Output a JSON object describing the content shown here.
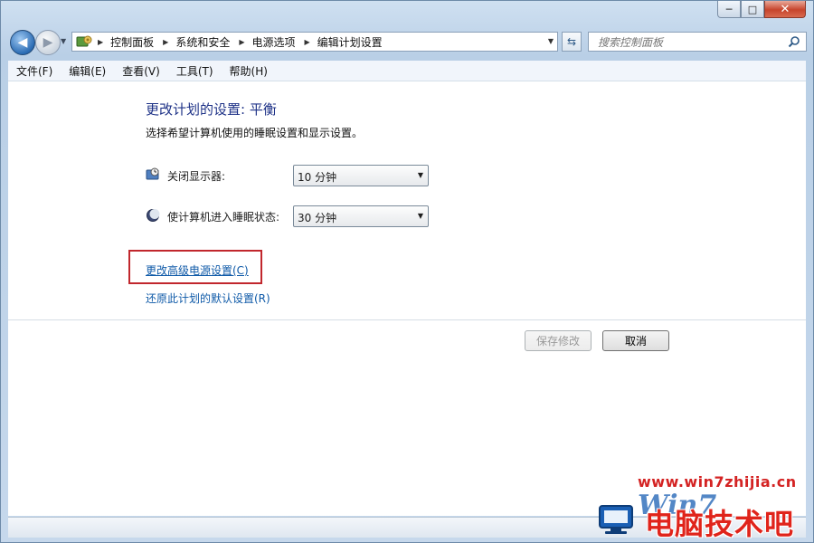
{
  "window": {
    "caption": {
      "minimize": "─",
      "maximize": "□",
      "close": "✕"
    }
  },
  "nav": {
    "breadcrumbs": [
      "控制面板",
      "系统和安全",
      "电源选项",
      "编辑计划设置"
    ],
    "search_placeholder": "搜索控制面板"
  },
  "menu": [
    "文件(F)",
    "编辑(E)",
    "查看(V)",
    "工具(T)",
    "帮助(H)"
  ],
  "content": {
    "title": "更改计划的设置: 平衡",
    "subtitle": "选择希望计算机使用的睡眠设置和显示设置。",
    "display_off": {
      "label": "关闭显示器:",
      "value": "10 分钟"
    },
    "sleep": {
      "label": "使计算机进入睡眠状态:",
      "value": "30 分钟"
    },
    "advanced_link": "更改高级电源设置(C)",
    "restore_link": "还原此计划的默认设置(R)",
    "save_button": "保存修改",
    "cancel_button": "取消"
  },
  "watermark": {
    "url": "www.win7zhijia.cn",
    "logo": "Win7",
    "text": "电脑技术吧"
  },
  "colors": {
    "title": "#1e3287",
    "link": "#0f5aa8",
    "highlight_box": "#c1272d",
    "watermark_red": "#e0241b"
  }
}
